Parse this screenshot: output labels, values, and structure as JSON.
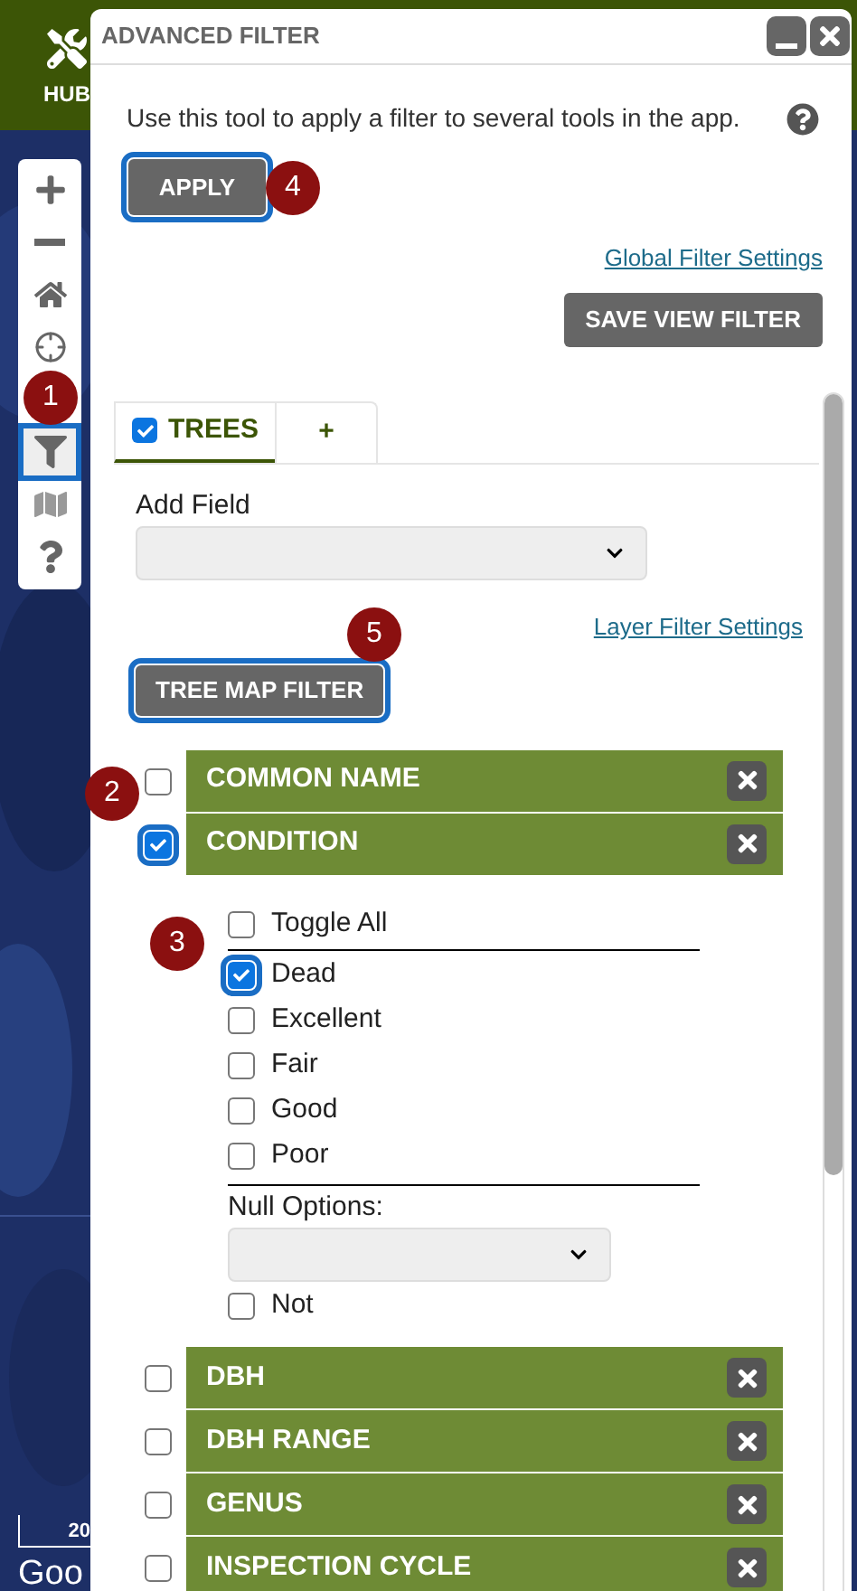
{
  "header": {
    "label": "HUB"
  },
  "map": {
    "scale": "20",
    "logo": "Goo"
  },
  "toolbar": {
    "items": [
      {
        "kind": "zoom-in",
        "selected": false
      },
      {
        "kind": "zoom-out",
        "selected": false
      },
      {
        "kind": "home",
        "selected": false
      },
      {
        "kind": "locate",
        "selected": false
      },
      {
        "kind": "filter",
        "selected": true
      },
      {
        "kind": "basemap",
        "selected": false
      },
      {
        "kind": "help",
        "selected": false
      }
    ]
  },
  "dialog": {
    "title": "ADVANCED FILTER",
    "description": "Use this tool to apply a filter to several tools in the app.",
    "apply_button": {
      "label": "APPLY",
      "highlighted": true
    },
    "global_link": "Global Filter Settings",
    "save_button": "SAVE VIEW FILTER",
    "tabs": [
      {
        "label": "TREES",
        "checked": true,
        "selected": true
      },
      {
        "label": "+",
        "selected": false
      }
    ],
    "add_field": {
      "label": "Add Field"
    },
    "layer_link": "Layer Filter Settings",
    "tree_map_button": {
      "label": "TREE MAP FILTER",
      "highlighted": true
    },
    "fields": [
      {
        "name": "COMMON NAME",
        "checked": false,
        "highlighted": false
      },
      {
        "name": "CONDITION",
        "checked": true,
        "highlighted": true,
        "toggle_all": {
          "label": "Toggle All",
          "checked": false
        },
        "options": [
          {
            "label": "Dead",
            "checked": true,
            "highlighted": true
          },
          {
            "label": "Excellent",
            "checked": false,
            "highlighted": false
          },
          {
            "label": "Fair",
            "checked": false,
            "highlighted": false
          },
          {
            "label": "Good",
            "checked": false,
            "highlighted": false
          },
          {
            "label": "Poor",
            "checked": false,
            "highlighted": false
          }
        ],
        "null_options": {
          "label": "Null Options:"
        },
        "not": {
          "label": "Not",
          "checked": false
        }
      },
      {
        "name": "DBH",
        "checked": false,
        "highlighted": false
      },
      {
        "name": "DBH RANGE",
        "checked": false,
        "highlighted": false
      },
      {
        "name": "GENUS",
        "checked": false,
        "highlighted": false
      },
      {
        "name": "INSPECTION CYCLE",
        "checked": false,
        "highlighted": false
      }
    ]
  },
  "callouts": [
    {
      "number": "1"
    },
    {
      "number": "4"
    },
    {
      "number": "5"
    },
    {
      "number": "2"
    },
    {
      "number": "3"
    }
  ]
}
